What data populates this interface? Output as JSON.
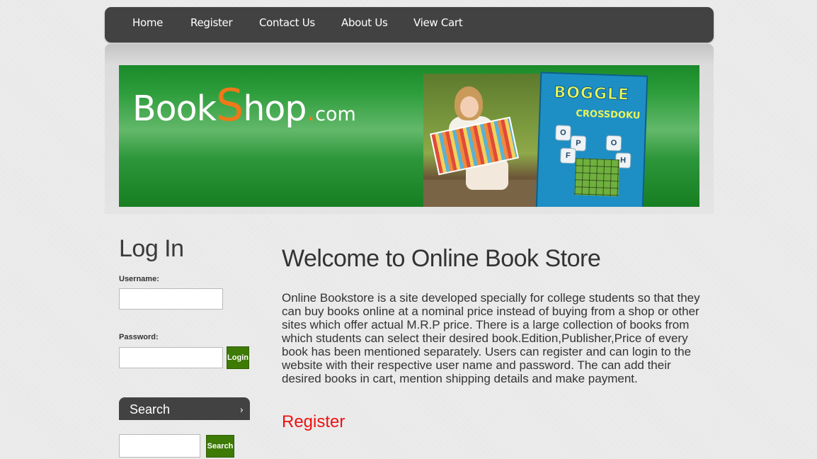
{
  "nav": {
    "items": [
      {
        "label": "Home"
      },
      {
        "label": "Register"
      },
      {
        "label": "Contact Us"
      },
      {
        "label": "About Us"
      },
      {
        "label": "View Cart"
      }
    ]
  },
  "header": {
    "logo": {
      "part1": "Book",
      "part2": "S",
      "part3": "hop",
      "dot": ".",
      "tld": "com"
    },
    "book_cover": {
      "title": "BOGGLE",
      "subtitle": "CROSSDOKU"
    }
  },
  "login": {
    "title": "Log In",
    "username_label": "Username:",
    "username_value": "",
    "password_label": "Password:",
    "password_value": "",
    "button_label": "Login"
  },
  "search": {
    "title": "Search",
    "query": "",
    "button_label": "Search"
  },
  "main": {
    "title": "Welcome to Online Book Store",
    "intro": "Online Bookstore is a site developed specially for college students so that they can buy books online at a nominal price instead of buying from a shop or other sites which offer actual M.R.P price. There is a large collection of books from which students can select their desired book.Edition,Publisher,Price of every book has been mentioned separately. Users can register and can login to the website with their respective user name and password. The can add their desired books in cart, mention shipping details and make payment.",
    "register_link": "Register"
  },
  "colors": {
    "nav_bg": "#424242",
    "banner_green": "#2e9e3c",
    "logo_orange": "#f07818",
    "button_green": "#3d7a06",
    "register_red": "#ee1111"
  }
}
